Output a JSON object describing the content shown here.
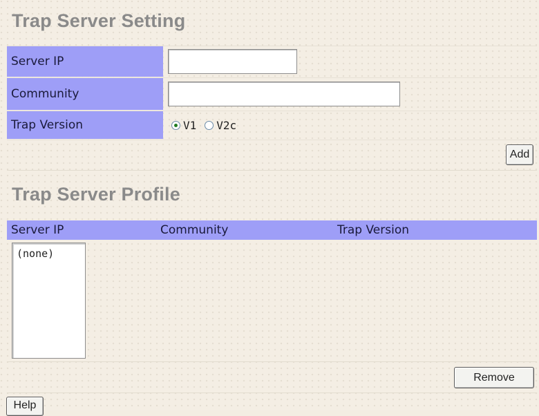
{
  "setting": {
    "title": "Trap Server Setting",
    "server_ip_label": "Server IP",
    "server_ip_value": "",
    "community_label": "Community",
    "community_value": "",
    "trap_version_label": "Trap Version",
    "trap_version_options": [
      "V1",
      "V2c"
    ],
    "trap_version_selected": "V1",
    "add_button": "Add"
  },
  "profile": {
    "title": "Trap Server Profile",
    "columns": [
      "Server IP",
      "Community",
      "Trap Version"
    ],
    "list_items": [
      "(none)"
    ],
    "remove_button": "Remove"
  },
  "footer": {
    "help_button": "Help"
  },
  "colors": {
    "label_bg": "#9e9ef7",
    "page_bg": "#f4eee4",
    "title_color": "#8a8a8a",
    "radio_selected": "#1f7a1f"
  }
}
